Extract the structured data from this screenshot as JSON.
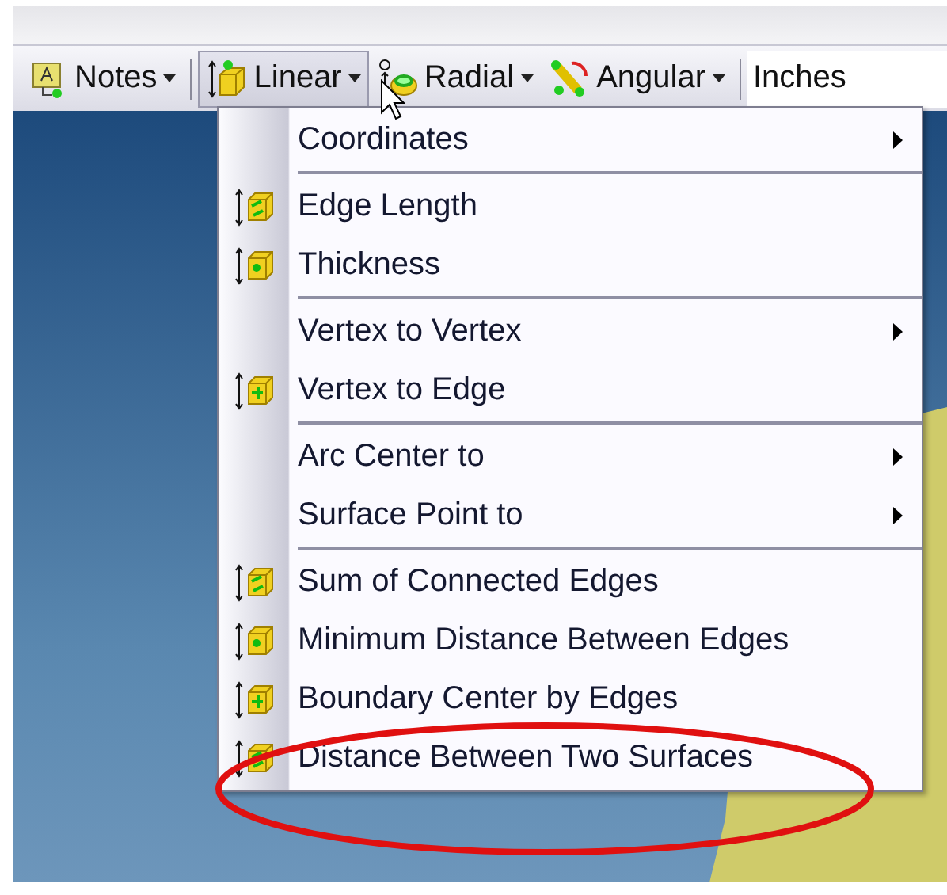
{
  "toolbar": {
    "items": [
      {
        "kind": "dropdown",
        "label": "Notes",
        "selected": false
      },
      {
        "kind": "dropdown",
        "label": "Linear",
        "selected": true
      },
      {
        "kind": "dropdown",
        "label": "Radial",
        "selected": false
      },
      {
        "kind": "dropdown",
        "label": "Angular",
        "selected": false
      },
      {
        "kind": "field",
        "label": "Inches"
      }
    ]
  },
  "menu": {
    "groups": [
      [
        {
          "label": "Coordinates",
          "kind": "submenu"
        }
      ],
      [
        {
          "label": "Edge Length",
          "kind": "command"
        },
        {
          "label": "Thickness",
          "kind": "command"
        }
      ],
      [
        {
          "label": "Vertex to Vertex",
          "kind": "submenu"
        },
        {
          "label": "Vertex to Edge",
          "kind": "command"
        }
      ],
      [
        {
          "label": "Arc Center to",
          "kind": "submenu"
        },
        {
          "label": "Surface Point to",
          "kind": "submenu"
        }
      ],
      [
        {
          "label": "Sum of Connected Edges",
          "kind": "command"
        },
        {
          "label": "Minimum Distance Between Edges",
          "kind": "command"
        },
        {
          "label": "Boundary Center by Edges",
          "kind": "command"
        },
        {
          "label": "Distance Between Two Surfaces",
          "kind": "command"
        }
      ]
    ]
  }
}
